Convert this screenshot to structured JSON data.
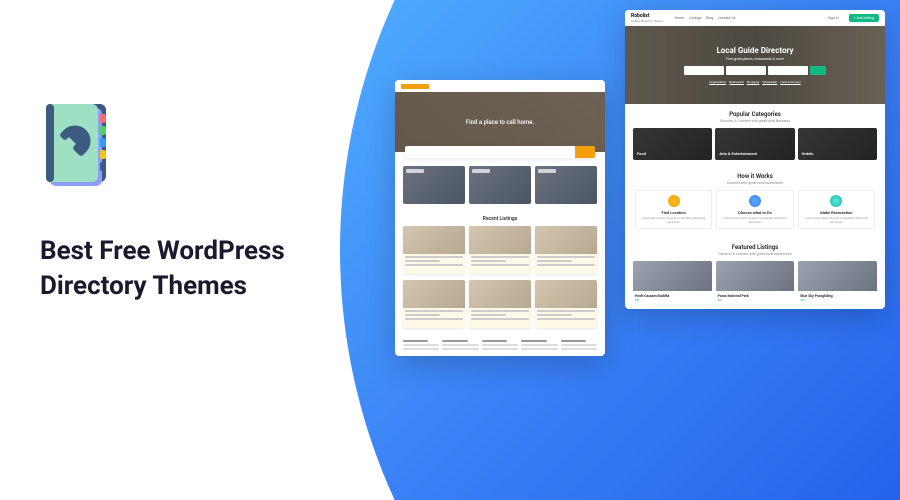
{
  "heading": "Best Free WordPress Directory Themes",
  "icon": "phonebook-icon",
  "mockup1": {
    "hero_title": "Find a place to call home.",
    "section_title": "Recent Listings"
  },
  "mockup2": {
    "brand": "Robolist",
    "brand_sub": "Listing Directory Theme",
    "nav": [
      "Home",
      "Listings",
      "Blog",
      "Contact Us"
    ],
    "signin": "Sign In",
    "add_btn": "+ Add Listing",
    "hero_title": "Local Guide Directory",
    "hero_sub": "Find great places, restaurants & more",
    "hero_search_btn": "Search",
    "hero_tags": [
      "Organization",
      "Restaurant",
      "Shopping",
      "Wholesaler",
      "Food & Grocery"
    ],
    "popular_title": "Popular Categories",
    "popular_sub": "Discover & Connect with great local Business",
    "categories": [
      "Food",
      "Arts & Entertainment",
      "Hotels"
    ],
    "how_title": "How it Works",
    "how_sub": "Connect with great local businesses",
    "works": [
      {
        "title": "Find Location",
        "text": "Lorem ipsum dolor sit amet consectetur adipiscing elit Donec"
      },
      {
        "title": "Choose what to Do",
        "text": "Lorem ipsum dolor sit amet consectetur adipiscing elit Donec"
      },
      {
        "title": "Make Reservation",
        "text": "Lorem ipsum dolor sit amet consectetur adipiscing elit Donec"
      }
    ],
    "featured_title": "Featured Listings",
    "featured_sub": "Discover & connect with great local businesses",
    "listings": [
      {
        "name": "Hotel Gautam Buddha",
        "price": "$50"
      },
      {
        "name": "Paras National Park",
        "price": "$30"
      },
      {
        "name": "Blue Sky Paragliding",
        "price": "$55"
      }
    ]
  }
}
